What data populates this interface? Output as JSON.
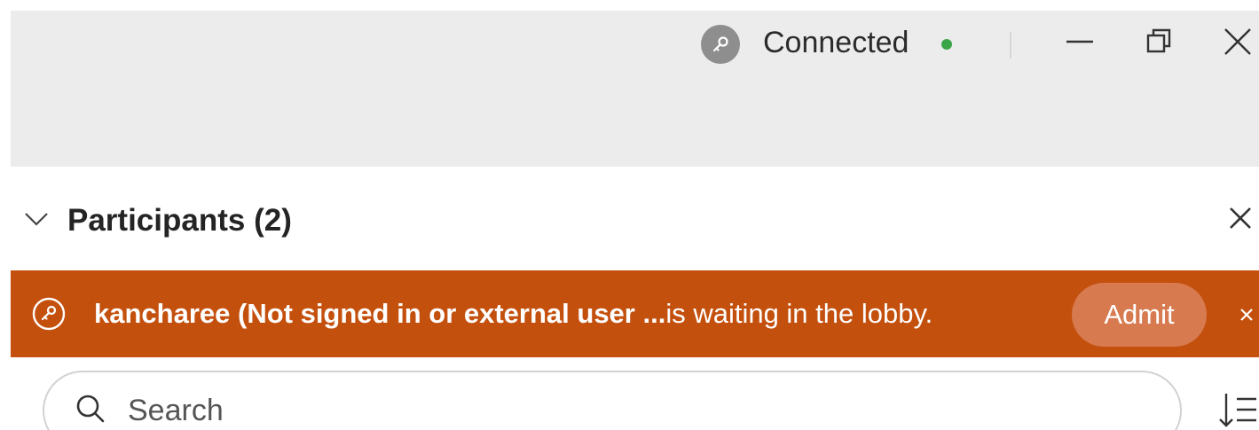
{
  "titlebar": {
    "status_label": "Connected",
    "status_color": "#3aa548",
    "status_icon": "key-icon",
    "window_buttons": [
      "minimize-icon",
      "restore-icon",
      "close-icon"
    ]
  },
  "participants": {
    "title": "Participants (2)",
    "collapse_icon": "chevron-down-icon",
    "close_icon": "close-icon"
  },
  "lobby_banner": {
    "background": "#c4500e",
    "icon": "key-icon",
    "user_text": "kancharee (Not signed in or external user ...",
    "message_text": "is waiting in the lobby.",
    "admit_label": "Admit",
    "close_icon": "close-icon"
  },
  "search": {
    "placeholder": "Search",
    "icon": "search-icon",
    "sort_icon": "sort-icon"
  }
}
